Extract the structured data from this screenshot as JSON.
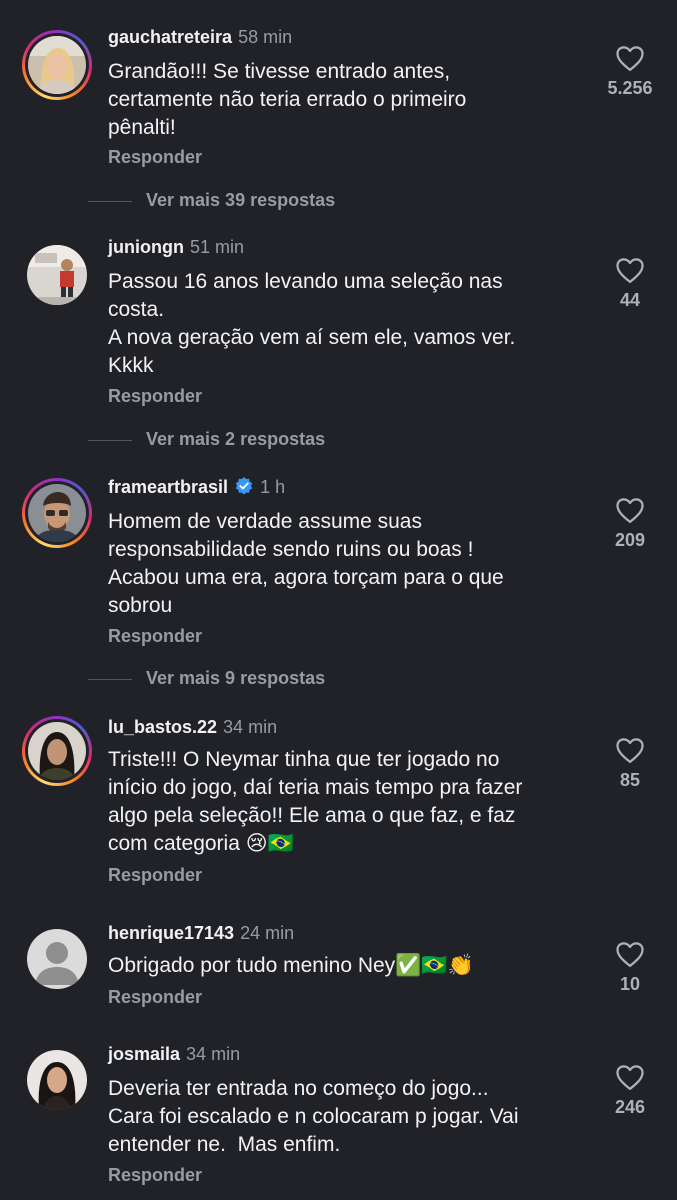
{
  "comments": [
    {
      "username": "gauchatreteira",
      "time": "58 min",
      "text": "Grandão!!! Se tivesse entrado antes, certamente não teria errado o primeiro pênalti!",
      "reply": "Responder",
      "likes": "5.256",
      "more": "Ver mais 39 respostas"
    },
    {
      "username": "juniongn",
      "time": "51 min",
      "text": "Passou 16 anos levando uma seleção nas costa.\nA nova geração vem aí sem ele, vamos ver. Kkkk",
      "reply": "Responder",
      "likes": "44",
      "more": "Ver mais 2 respostas"
    },
    {
      "username": "frameartbrasil",
      "time": "1 h",
      "text": "Homem de verdade assume suas responsabilidade sendo ruins ou boas ! Acabou uma era, agora torçam para o que sobrou",
      "reply": "Responder",
      "likes": "209",
      "more": "Ver mais 9 respostas"
    },
    {
      "username": "lu_bastos.22",
      "time": "34 min",
      "text": "Triste!!! O Neymar tinha que ter jogado no início do jogo, daí teria mais tempo pra fazer algo pela seleção!! Ele ama o que faz, e faz com categoria 😢🇧🇷",
      "reply": "Responder",
      "likes": "85"
    },
    {
      "username": "henrique17143",
      "time": "24 min",
      "text": "Obrigado por tudo menino Ney✅🇧🇷👏",
      "reply": "Responder",
      "likes": "10"
    },
    {
      "username": "josmaila",
      "time": "34 min",
      "text": "Deveria ter entrada no começo do jogo... Cara foi escalado e n colocaram p jogar. Vai entender ne.  Mas enfim.",
      "reply": "Responder",
      "likes": "246"
    }
  ],
  "icons": {
    "like": "heart-outline-icon",
    "verified": "verified-badge-icon",
    "default_avatar": "default-user-avatar"
  },
  "colors": {
    "background": "#212228",
    "muted": "#9a9ba2",
    "verified": "#3897f0"
  }
}
